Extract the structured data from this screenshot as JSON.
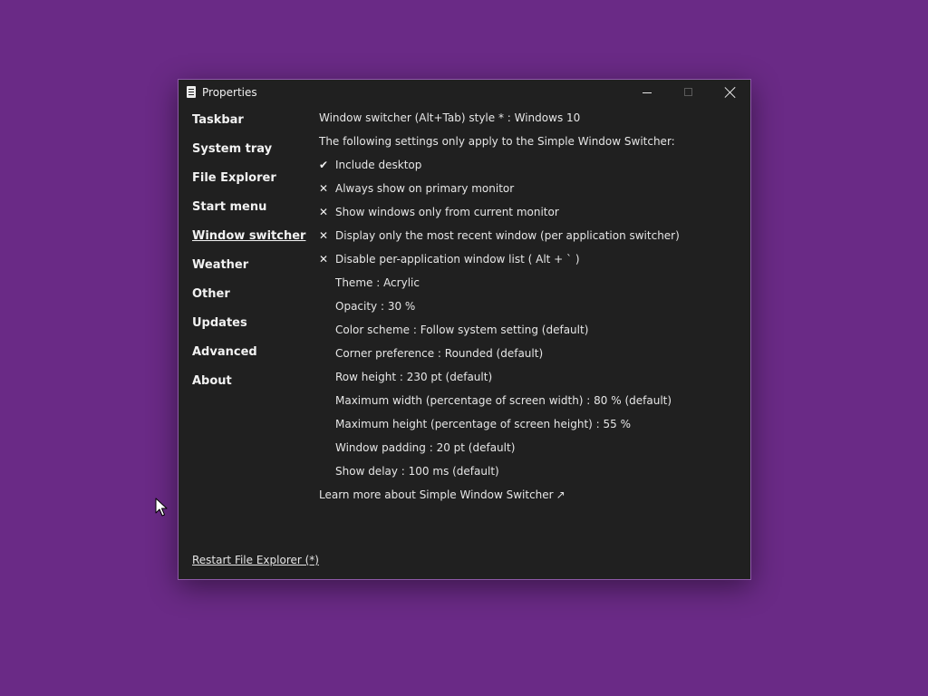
{
  "window": {
    "title": "Properties"
  },
  "sidebar": {
    "items": [
      {
        "label": "Taskbar"
      },
      {
        "label": "System tray"
      },
      {
        "label": "File Explorer"
      },
      {
        "label": "Start menu"
      },
      {
        "label": "Window switcher",
        "active": true
      },
      {
        "label": "Weather"
      },
      {
        "label": "Other"
      },
      {
        "label": "Updates"
      },
      {
        "label": "Advanced"
      },
      {
        "label": "About"
      }
    ],
    "restart_link": "Restart File Explorer (*)"
  },
  "content": {
    "style_setting": "Window switcher (Alt+Tab) style * : Windows 10",
    "simple_switcher_note": "The following settings only apply to the Simple Window Switcher:",
    "toggles": [
      {
        "mark": "✔",
        "label": "Include desktop",
        "checked": true
      },
      {
        "mark": "✕",
        "label": "Always show on primary monitor",
        "checked": false
      },
      {
        "mark": "✕",
        "label": "Show windows only from current monitor",
        "checked": false
      },
      {
        "mark": "✕",
        "label": "Display only the most recent window (per application switcher)",
        "checked": false
      },
      {
        "mark": "✕",
        "label": "Disable per-application window list ( Alt + ` )",
        "checked": false
      }
    ],
    "settings": [
      {
        "label": "Theme : Acrylic"
      },
      {
        "label": "Opacity : 30 %"
      },
      {
        "label": "Color scheme : Follow system setting (default)"
      },
      {
        "label": "Corner preference : Rounded (default)"
      },
      {
        "label": "Row height : 230 pt (default)"
      },
      {
        "label": "Maximum width (percentage of screen width) : 80 % (default)"
      },
      {
        "label": "Maximum height (percentage of screen height) : 55 %"
      },
      {
        "label": "Window padding : 20 pt (default)"
      },
      {
        "label": "Show delay : 100 ms (default)"
      }
    ],
    "learn_more": "Learn more about Simple Window Switcher",
    "learn_more_arrow": "↗"
  },
  "colors": {
    "desktop": "#6a2a86",
    "window_bg": "#202020",
    "window_border": "#8e5aa8",
    "text": "#e6e6e6"
  },
  "icons": {
    "app": "properties-document-icon",
    "minimize": "minimize-icon",
    "maximize": "maximize-icon",
    "close": "close-icon",
    "cursor": "mouse-pointer-icon"
  }
}
